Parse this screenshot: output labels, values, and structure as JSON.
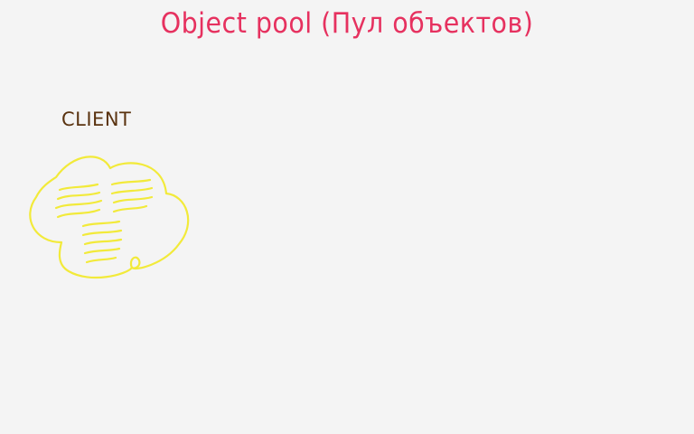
{
  "diagram": {
    "title": "Object pool (Пул объектов)",
    "client_label": "CLIENT",
    "colors": {
      "background": "#f4f4f4",
      "title": "#e6315f",
      "label": "#5a3310",
      "cloud": "#f2ea3a"
    }
  }
}
